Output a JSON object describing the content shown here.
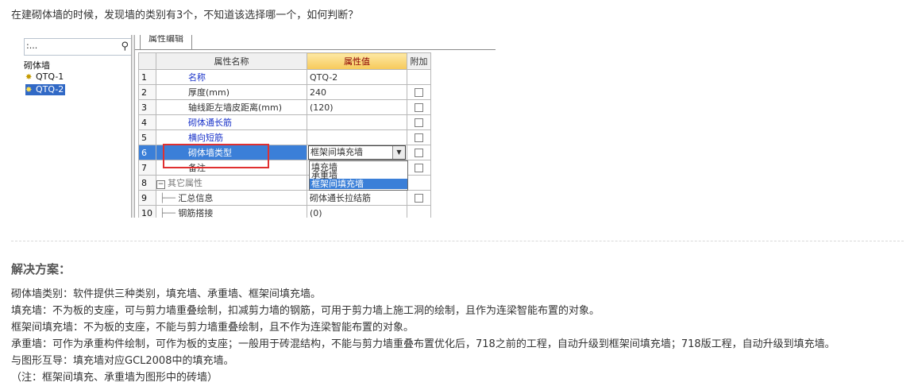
{
  "question": "在建砌体墙的时候，发现墙的类别有3个，不知道该选择哪一个，如何判断？",
  "left_panel": {
    "search_text": ":...",
    "tree_root": "砌体墙",
    "items": [
      "QTQ-1",
      "QTQ-2"
    ]
  },
  "tab_label": "属性编辑",
  "grid": {
    "headers": {
      "name": "属性名称",
      "value": "属性值",
      "extra": "附加"
    },
    "rows": [
      {
        "num": "1",
        "name": "名称",
        "value": "QTQ-2"
      },
      {
        "num": "2",
        "name": "厚度(mm)",
        "value": "240"
      },
      {
        "num": "3",
        "name": "轴线距左墙皮距离(mm)",
        "value": "(120)"
      },
      {
        "num": "4",
        "name": "砌体通长筋",
        "value": ""
      },
      {
        "num": "5",
        "name": "横向短筋",
        "value": ""
      },
      {
        "num": "6",
        "name": "砌体墙类型",
        "value": "框架间填充墙"
      },
      {
        "num": "7",
        "name": "备注",
        "value": ""
      },
      {
        "num": "8",
        "name": "其它属性",
        "value": ""
      },
      {
        "num": "9",
        "name": "汇总信息",
        "value": "砌体通长拉结筋"
      },
      {
        "num": "10",
        "name": "钢筋搭接",
        "value": "(0)"
      }
    ]
  },
  "dropdown_options": [
    "填充墙",
    "承重墙",
    "框架间填充墙"
  ],
  "solution": {
    "title": "解决方案：",
    "lines": [
      "砌体墙类别：软件提供三种类别，填充墙、承重墙、框架间填充墙。",
      "填充墙：不为板的支座，可与剪力墙重叠绘制，扣减剪力墙的钢筋，可用于剪力墙上施工洞的绘制，且作为连梁智能布置的对象。",
      "框架间填充墙：不为板的支座，不能与剪力墙重叠绘制，且不作为连梁智能布置的对象。",
      "承重墙：可作为承重构件绘制，可作为板的支座；一般用于砖混结构，不能与剪力墙重叠布置优化后，718之前的工程，自动升级到框架间填充墙；718版工程，自动升级到填充墙。",
      "与图形互导：填充墙对应GCL2008中的填充墙。",
      "（注：框架间填充、承重墙为图形中的砖墙）"
    ]
  },
  "colors": {
    "selection": "#3b7fd8",
    "highlight_box": "#e03030",
    "value_header": "#f6c95a"
  }
}
